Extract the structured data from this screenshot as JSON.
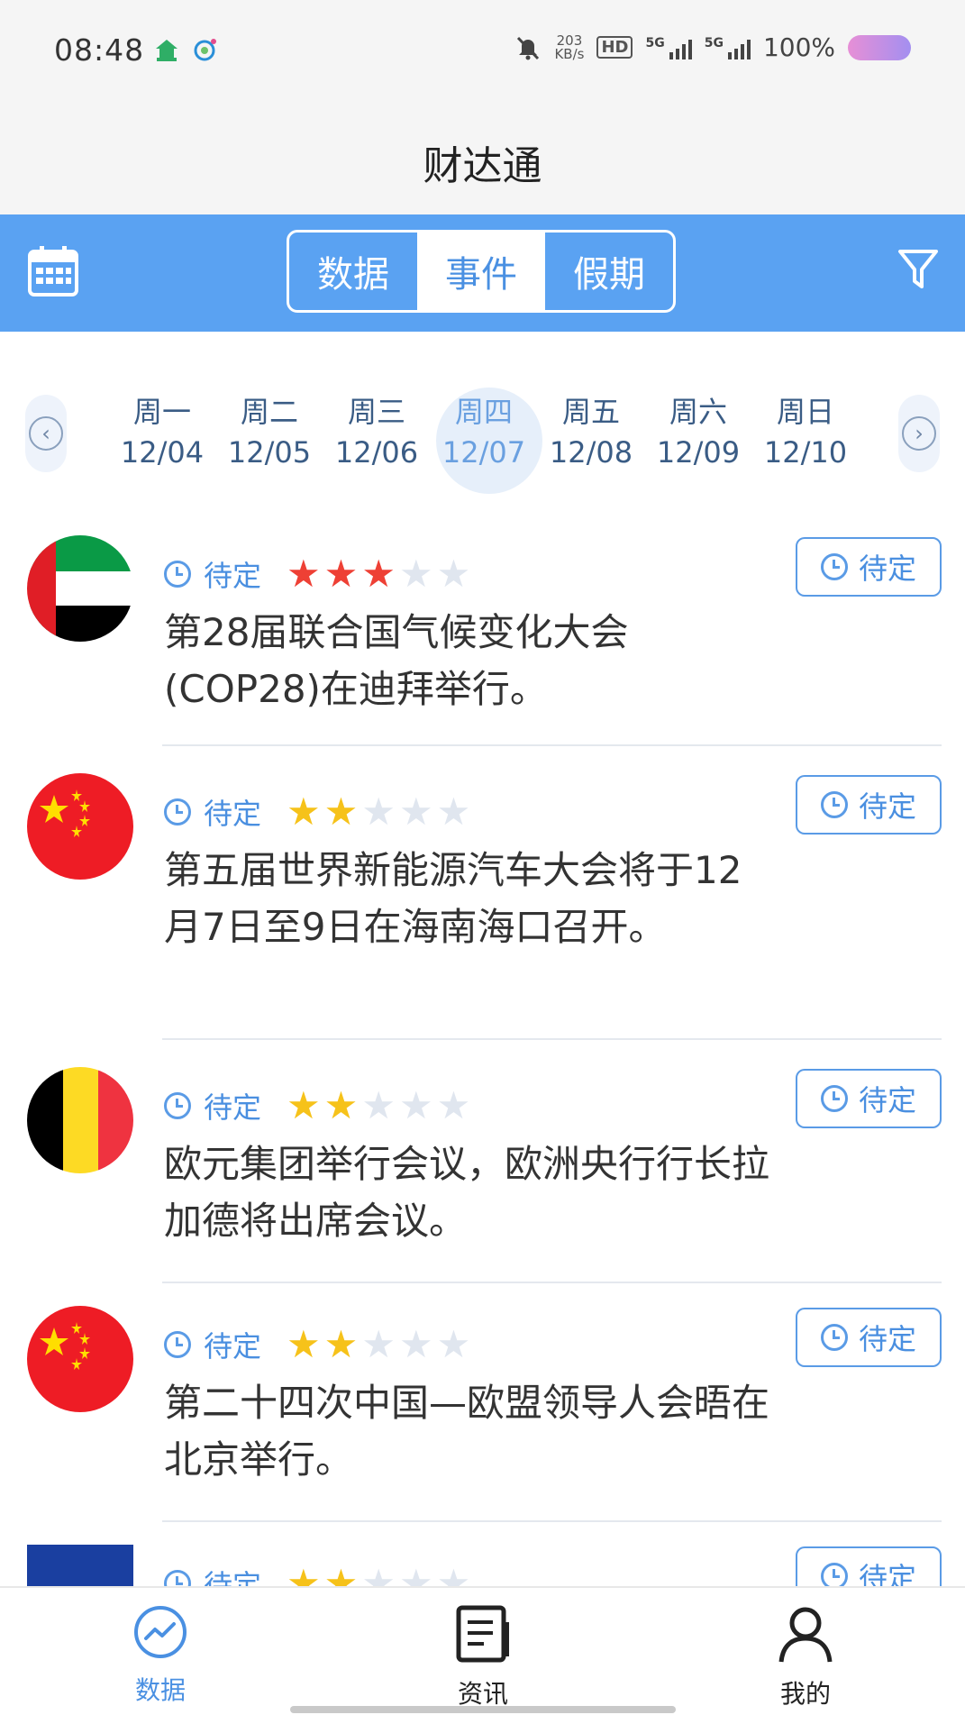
{
  "status_bar": {
    "time": "08:48",
    "net_speed_value": "203",
    "net_speed_unit": "KB/s",
    "hd_label": "HD",
    "signal1": "5G",
    "signal2": "5G",
    "battery": "100%"
  },
  "header": {
    "title": "财达通"
  },
  "toolbar": {
    "tabs": [
      {
        "label": "数据"
      },
      {
        "label": "事件"
      },
      {
        "label": "假期"
      }
    ]
  },
  "week": {
    "days": [
      {
        "name": "周一",
        "date": "12/04"
      },
      {
        "name": "周二",
        "date": "12/05"
      },
      {
        "name": "周三",
        "date": "12/06"
      },
      {
        "name": "周四",
        "date": "12/07"
      },
      {
        "name": "周五",
        "date": "12/08"
      },
      {
        "name": "周六",
        "date": "12/09"
      },
      {
        "name": "周日",
        "date": "12/10"
      }
    ]
  },
  "events": [
    {
      "status": "待定",
      "stars": 3,
      "star_color": "#ee4035",
      "title": "第28届联合国气候变化大会(COP28)在迪拜举行。",
      "button": "待定",
      "flag": "uae"
    },
    {
      "status": "待定",
      "stars": 2,
      "star_color": "#f6c21a",
      "title": "第五届世界新能源汽车大会将于12月7日至9日在海南海口召开。",
      "button": "待定",
      "flag": "china"
    },
    {
      "status": "待定",
      "stars": 2,
      "star_color": "#f6c21a",
      "title": "欧元集团举行会议，欧洲央行行长拉加德将出席会议。",
      "button": "待定",
      "flag": "belgium"
    },
    {
      "status": "待定",
      "stars": 2,
      "star_color": "#f6c21a",
      "title": "第二十四次中国—欧盟领导人会晤在北京举行。",
      "button": "待定",
      "flag": "china"
    },
    {
      "status": "待定",
      "stars": 2,
      "star_color": "#f6c21a",
      "title": "",
      "button": "待定",
      "flag": "eu"
    }
  ],
  "bottom_nav": {
    "items": [
      {
        "label": "数据"
      },
      {
        "label": "资讯"
      },
      {
        "label": "我的"
      }
    ]
  }
}
